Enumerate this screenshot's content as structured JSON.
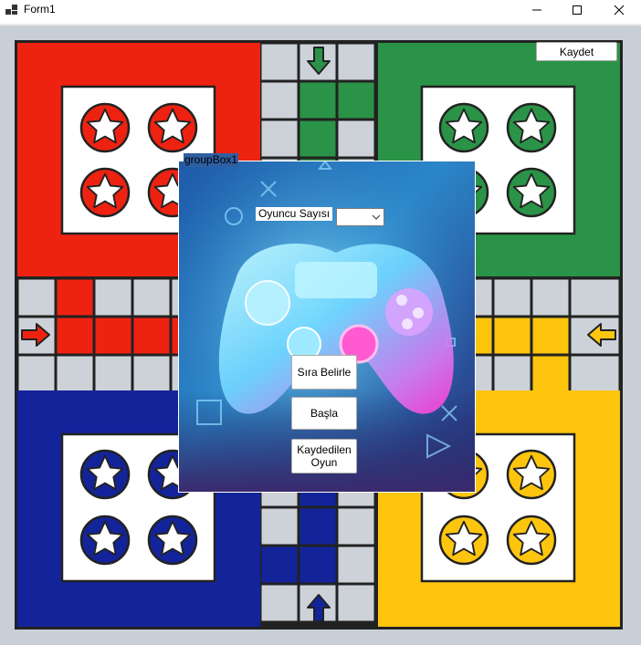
{
  "window": {
    "title": "Form1"
  },
  "toolbar": {
    "save_label": "Kaydet"
  },
  "groupbox": {
    "title": "groupBox1",
    "player_count_label": "Oyuncu Sayısı",
    "player_count_value": "",
    "order_button": "Sıra Belirle",
    "start_button": "Başla",
    "saved_game_button": "Kaydedilen Oyun"
  },
  "colors": {
    "red": "#ee2211",
    "green": "#2a9347",
    "blue": "#13249a",
    "yellow": "#fec50e",
    "cell": "#ccd2d8"
  }
}
